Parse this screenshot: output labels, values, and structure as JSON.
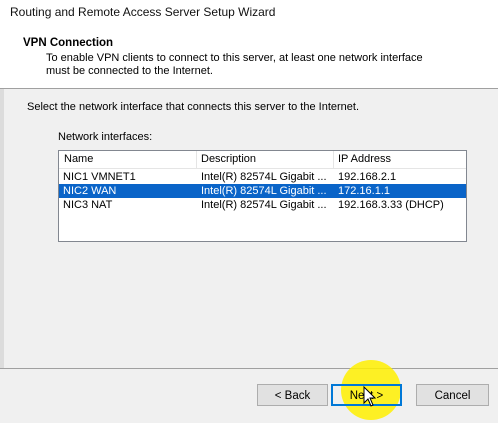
{
  "window": {
    "title": "Routing and Remote Access Server Setup Wizard"
  },
  "header": {
    "title": "VPN Connection",
    "description": "To enable VPN clients to connect to this server, at least one network interface must be connected to the Internet."
  },
  "body": {
    "instruction": "Select the network interface that connects this server to the Internet.",
    "list_label": "Network interfaces:",
    "columns": [
      "Name",
      "Description",
      "IP Address"
    ],
    "rows": [
      {
        "name": "NIC1 VMNET1",
        "description": "Intel(R) 82574L Gigabit ...",
        "ip": "192.168.2.1",
        "selected": false
      },
      {
        "name": "NIC2 WAN",
        "description": "Intel(R) 82574L Gigabit ...",
        "ip": "172.16.1.1",
        "selected": true
      },
      {
        "name": "NIC3 NAT",
        "description": "Intel(R) 82574L Gigabit ...",
        "ip": "192.168.3.33 (DHCP)",
        "selected": false
      }
    ]
  },
  "buttons": {
    "back": "< Back",
    "next": "Next >",
    "cancel": "Cancel"
  },
  "colors": {
    "selection": "#0a64c8",
    "highlight": "#fff000",
    "default_button_border": "#0078d7"
  },
  "icons": {
    "cursor": "mouse-pointer-icon"
  }
}
